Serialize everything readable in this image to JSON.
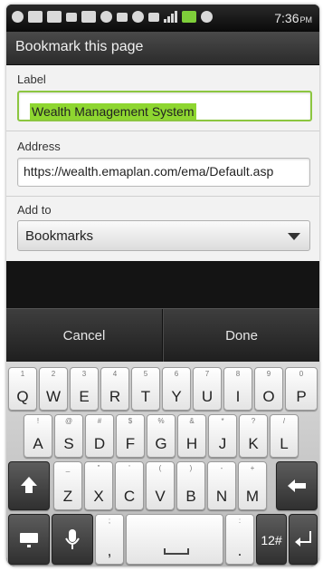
{
  "status_bar": {
    "time": "7:36",
    "ampm": "PM",
    "icons": [
      "notification-icon",
      "email-icon",
      "message-icon",
      "voicemail-icon",
      "image-icon",
      "wifi-icon",
      "usb-icon",
      "gps-icon",
      "3g-icon",
      "signal-icon",
      "battery-icon",
      "alarm-icon"
    ]
  },
  "dialog": {
    "title": "Bookmark this page",
    "label_caption": "Label",
    "label_value": "Wealth Management System",
    "address_caption": "Address",
    "address_value": "https://wealth.emaplan.com/ema/Default.asp",
    "addto_caption": "Add to",
    "addto_value": "Bookmarks",
    "cancel_label": "Cancel",
    "done_label": "Done"
  },
  "keyboard": {
    "row1": [
      {
        "k": "Q",
        "h": "1"
      },
      {
        "k": "W",
        "h": "2"
      },
      {
        "k": "E",
        "h": "3"
      },
      {
        "k": "R",
        "h": "4"
      },
      {
        "k": "T",
        "h": "5"
      },
      {
        "k": "Y",
        "h": "6"
      },
      {
        "k": "U",
        "h": "7"
      },
      {
        "k": "I",
        "h": "8"
      },
      {
        "k": "O",
        "h": "9"
      },
      {
        "k": "P",
        "h": "0"
      }
    ],
    "row2": [
      {
        "k": "A",
        "h": "!"
      },
      {
        "k": "S",
        "h": "@"
      },
      {
        "k": "D",
        "h": "#"
      },
      {
        "k": "F",
        "h": "$"
      },
      {
        "k": "G",
        "h": "%"
      },
      {
        "k": "H",
        "h": "&"
      },
      {
        "k": "J",
        "h": "*"
      },
      {
        "k": "K",
        "h": "?"
      },
      {
        "k": "L",
        "h": "/"
      }
    ],
    "row3": [
      {
        "k": "Z",
        "h": "_"
      },
      {
        "k": "X",
        "h": "\""
      },
      {
        "k": "C",
        "h": "'"
      },
      {
        "k": "V",
        "h": "("
      },
      {
        "k": "B",
        "h": ")"
      },
      {
        "k": "N",
        "h": "-"
      },
      {
        "k": "M",
        "h": "+"
      }
    ],
    "shift_icon": "shift-icon",
    "backspace_icon": "backspace-icon",
    "comma_key": ",",
    "comma_hint": ";",
    "period_key": ".",
    "period_hint": ":",
    "symbols_label": "12#",
    "enter_icon": "enter-icon",
    "keyboard_settings_icon": "keyboard-icon",
    "mic_icon": "microphone-icon"
  }
}
